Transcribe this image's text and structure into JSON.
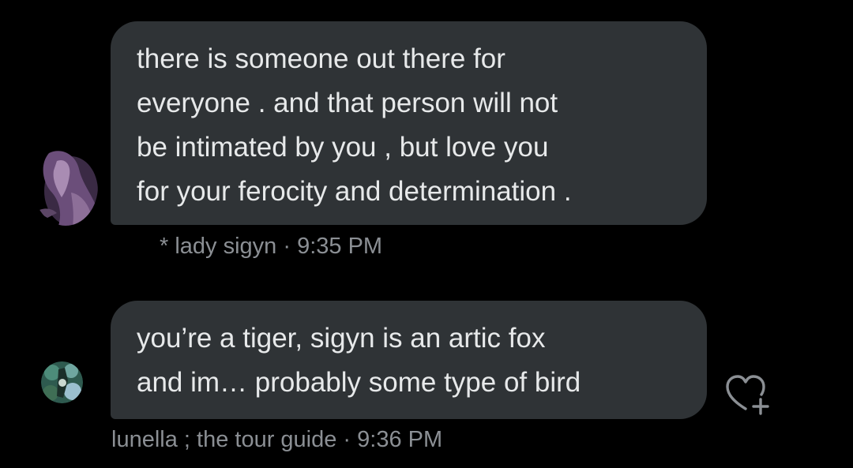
{
  "messages": [
    {
      "lines": [
        "there is someone out there for",
        "everyone . and that person will not",
        "be intimated by you , but love you",
        "for your ferocity and determination ."
      ],
      "meta": "* lady sigyn · 9:35 PM"
    },
    {
      "lines": [
        "you’re a tiger, sigyn is an artic fox",
        "and im… probably some type of bird"
      ],
      "meta": "lunella ; the tour guide · 9:36 PM"
    }
  ],
  "icons": {
    "react": "heart-plus-icon"
  },
  "colors": {
    "background": "#000000",
    "bubble": "#2f3336",
    "text": "#e7e9ea",
    "meta": "#8b8f94"
  }
}
